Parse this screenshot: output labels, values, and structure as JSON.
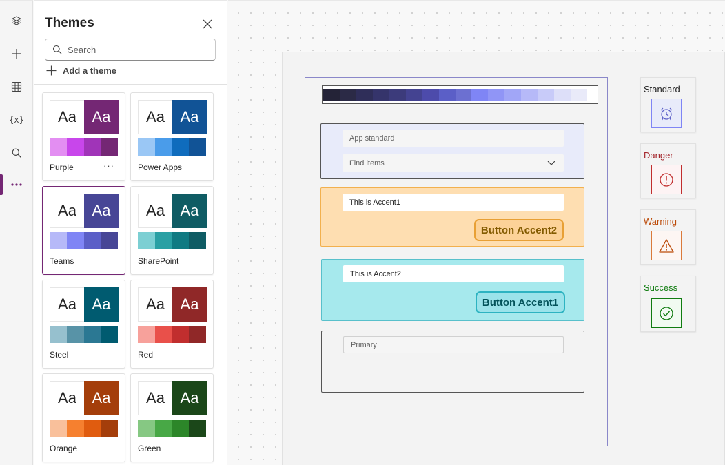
{
  "rail": {
    "items": [
      {
        "name": "layers",
        "active": false
      },
      {
        "name": "insert",
        "active": false
      },
      {
        "name": "data",
        "active": false
      },
      {
        "name": "variables",
        "label": "{x}",
        "active": false
      },
      {
        "name": "search",
        "active": false
      },
      {
        "name": "more",
        "active": true
      }
    ],
    "accent_color": "#742774"
  },
  "panel": {
    "title": "Themes",
    "search_placeholder": "Search",
    "add_theme_label": "Add a theme",
    "themes": [
      {
        "name": "Purple",
        "aa": "Aa",
        "dark": "#742774",
        "swatches": [
          "#e38ef2",
          "#c846eb",
          "#a034b8",
          "#742774"
        ],
        "more": "···",
        "selected": false
      },
      {
        "name": "Power Apps",
        "aa": "Aa",
        "dark": "#115396",
        "swatches": [
          "#9ac7f5",
          "#4a9cea",
          "#0f6cbd",
          "#115396"
        ],
        "selected": false
      },
      {
        "name": "Teams",
        "aa": "Aa",
        "dark": "#474696",
        "swatches": [
          "#b6b9f8",
          "#7f85f5",
          "#5b5fc7",
          "#474696"
        ],
        "selected": true
      },
      {
        "name": "SharePoint",
        "aa": "Aa",
        "dark": "#0f5c64",
        "swatches": [
          "#7ccfd3",
          "#2aa0a4",
          "#107a82",
          "#0f5c64"
        ],
        "selected": false
      },
      {
        "name": "Steel",
        "aa": "Aa",
        "dark": "#005b70",
        "swatches": [
          "#96c0ce",
          "#5893a7",
          "#2b7893",
          "#005b70"
        ],
        "selected": false
      },
      {
        "name": "Red",
        "aa": "Aa",
        "dark": "#902828",
        "swatches": [
          "#f7a19b",
          "#e9504a",
          "#c12e2e",
          "#902828"
        ],
        "selected": false
      },
      {
        "name": "Orange",
        "aa": "Aa",
        "dark": "#a43e0b",
        "swatches": [
          "#f9c09b",
          "#f6802f",
          "#e05c0f",
          "#a43e0b"
        ],
        "selected": false
      },
      {
        "name": "Green",
        "aa": "Aa",
        "dark": "#1b4719",
        "swatches": [
          "#86c883",
          "#48a846",
          "#2c8629",
          "#1b4719"
        ],
        "selected": false
      }
    ]
  },
  "canvas": {
    "palette": [
      "#242337",
      "#2b2a46",
      "#2f2e59",
      "#35346b",
      "#3c3b7b",
      "#444391",
      "#4d4bab",
      "#5b5fc7",
      "#6c70d1",
      "#7f85f5",
      "#9095f6",
      "#a1a6f7",
      "#b6b9f8",
      "#c8cbf9",
      "#dddff9",
      "#e9eaf9"
    ],
    "standard": {
      "input_placeholder": "App standard",
      "dropdown_placeholder": "Find items"
    },
    "accent1": {
      "input_value": "This is Accent1",
      "button_label": "Button Accent2"
    },
    "accent2": {
      "input_value": "This is Accent2",
      "button_label": "Button Accent1"
    },
    "primary": {
      "input_placeholder": "Primary"
    },
    "statuses": [
      {
        "label": "Standard",
        "icon": "alarm-clock-icon",
        "text_color": "#242424",
        "border_color": "#7f85f5",
        "fill": "#e8ebfa",
        "icon_color": "#5b5fc7"
      },
      {
        "label": "Danger",
        "icon": "error-circle-icon",
        "text_color": "#a4262c",
        "border_color": "#c12e2e",
        "fill": "#fdf3f4",
        "icon_color": "#c12e2e"
      },
      {
        "label": "Warning",
        "icon": "warning-triangle-icon",
        "text_color": "#bc4b09",
        "border_color": "#da7a3b",
        "fill": "#fdf6f3",
        "icon_color": "#bc4b09"
      },
      {
        "label": "Success",
        "icon": "checkmark-circle-icon",
        "text_color": "#107c10",
        "border_color": "#107c10",
        "fill": "#f1faf1",
        "icon_color": "#107c10"
      }
    ]
  }
}
